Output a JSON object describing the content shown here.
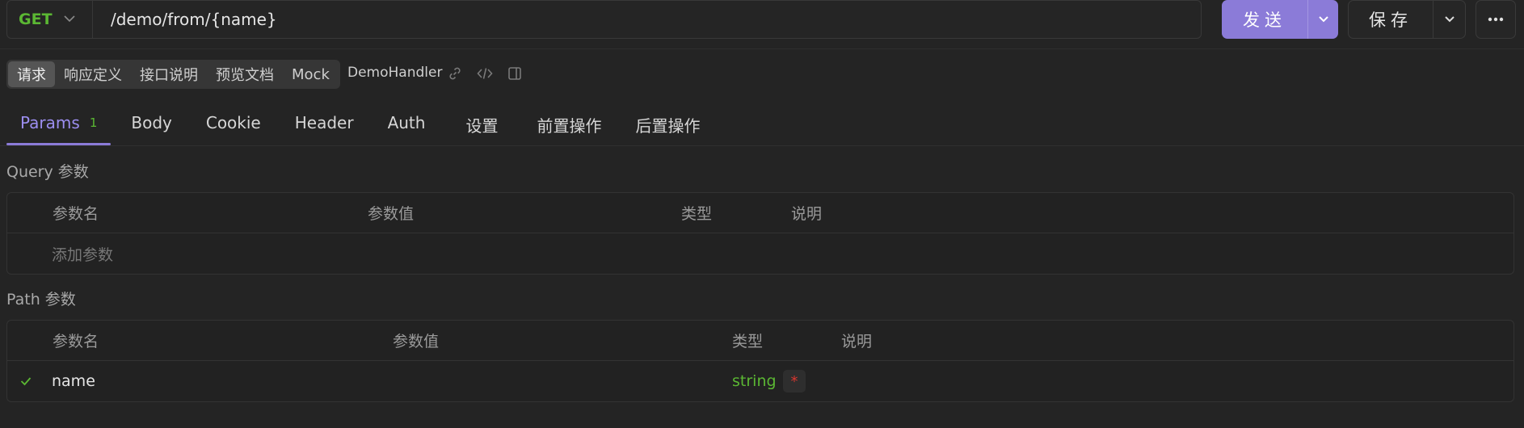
{
  "request": {
    "method": "GET",
    "url": "/demo/from/{name}"
  },
  "actions": {
    "send_label": "发送",
    "save_label": "保存"
  },
  "segment_tabs": [
    "请求",
    "响应定义",
    "接口说明",
    "预览文档",
    "Mock"
  ],
  "handler_name": "DemoHandler",
  "tabs": [
    {
      "label": "Params",
      "count": "1"
    },
    {
      "label": "Body"
    },
    {
      "label": "Cookie"
    },
    {
      "label": "Header"
    },
    {
      "label": "Auth"
    },
    {
      "label": "设置"
    },
    {
      "label": "前置操作"
    },
    {
      "label": "后置操作"
    }
  ],
  "query_section": {
    "title": "Query 参数",
    "headers": [
      "参数名",
      "参数值",
      "类型",
      "说明"
    ],
    "add_placeholder": "添加参数"
  },
  "path_section": {
    "title": "Path 参数",
    "headers": [
      "参数名",
      "参数值",
      "类型",
      "说明"
    ],
    "rows": [
      {
        "name": "name",
        "value": "",
        "type": "string",
        "required_mark": "*",
        "description": ""
      }
    ]
  },
  "colors": {
    "accent": "#8b7bd8",
    "method_get": "#5bb733",
    "type_string": "#5bb733",
    "required": "#d9362f",
    "background": "#242424"
  },
  "icons": [
    "chevron-down-icon",
    "more-icon",
    "link-icon",
    "code-icon",
    "panel-icon",
    "check-icon"
  ]
}
